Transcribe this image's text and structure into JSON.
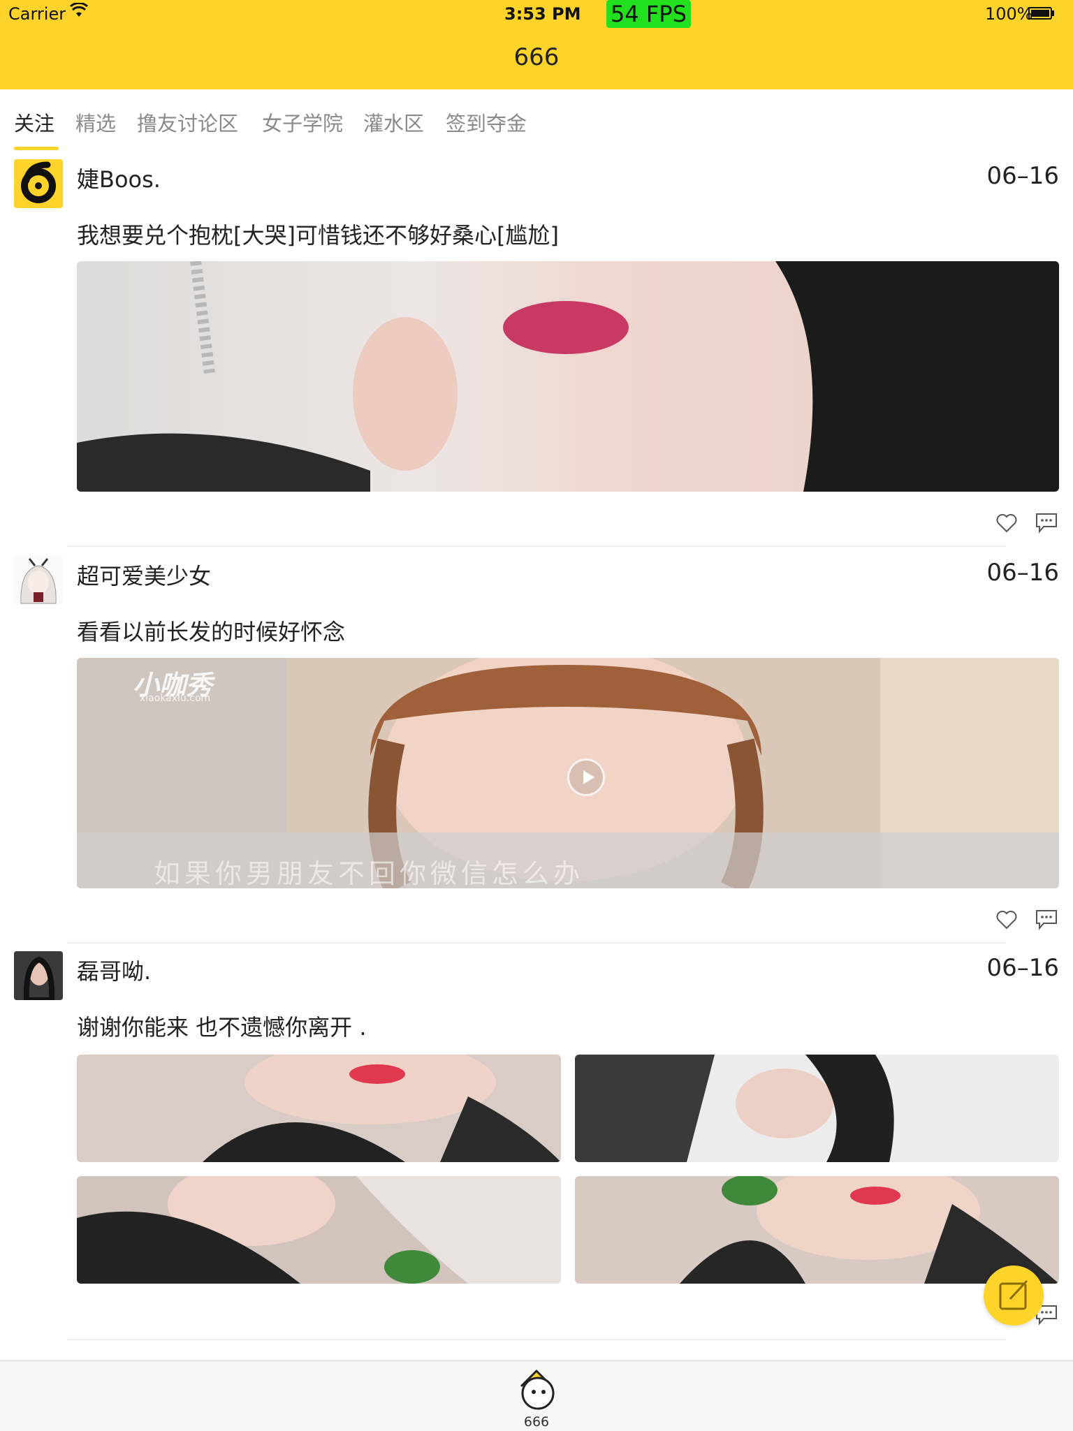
{
  "status_bar": {
    "carrier": "Carrier",
    "time": "3:53 PM",
    "fps": "54 FPS",
    "battery": "100%"
  },
  "nav": {
    "title": "666"
  },
  "tabs": [
    {
      "label": "关注",
      "active": true
    },
    {
      "label": "精选"
    },
    {
      "label": "撸友讨论区"
    },
    {
      "label": "女子学院"
    },
    {
      "label": "灌水区"
    },
    {
      "label": "签到夺金"
    }
  ],
  "posts": [
    {
      "user": "婕Boos.",
      "date": "06–16",
      "text": "我想要兑个抱枕[大哭]可惜钱还不够好桑心[尴尬]"
    },
    {
      "user": "超可爱美少女",
      "date": "06–16",
      "text": "看看以前长发的时候好怀念",
      "video_watermark_top": "小咖秀",
      "video_watermark_url": "xiaokaxiu.com",
      "video_caption": "如果你男朋友不回你微信怎么办"
    },
    {
      "user": "磊哥呦.",
      "date": "06–16",
      "text": "谢谢你能来 也不遗憾你离开 ."
    }
  ],
  "tabbar": {
    "label": "666"
  },
  "colors": {
    "accent": "#FFD42A",
    "fps_bg": "#22e01e"
  }
}
